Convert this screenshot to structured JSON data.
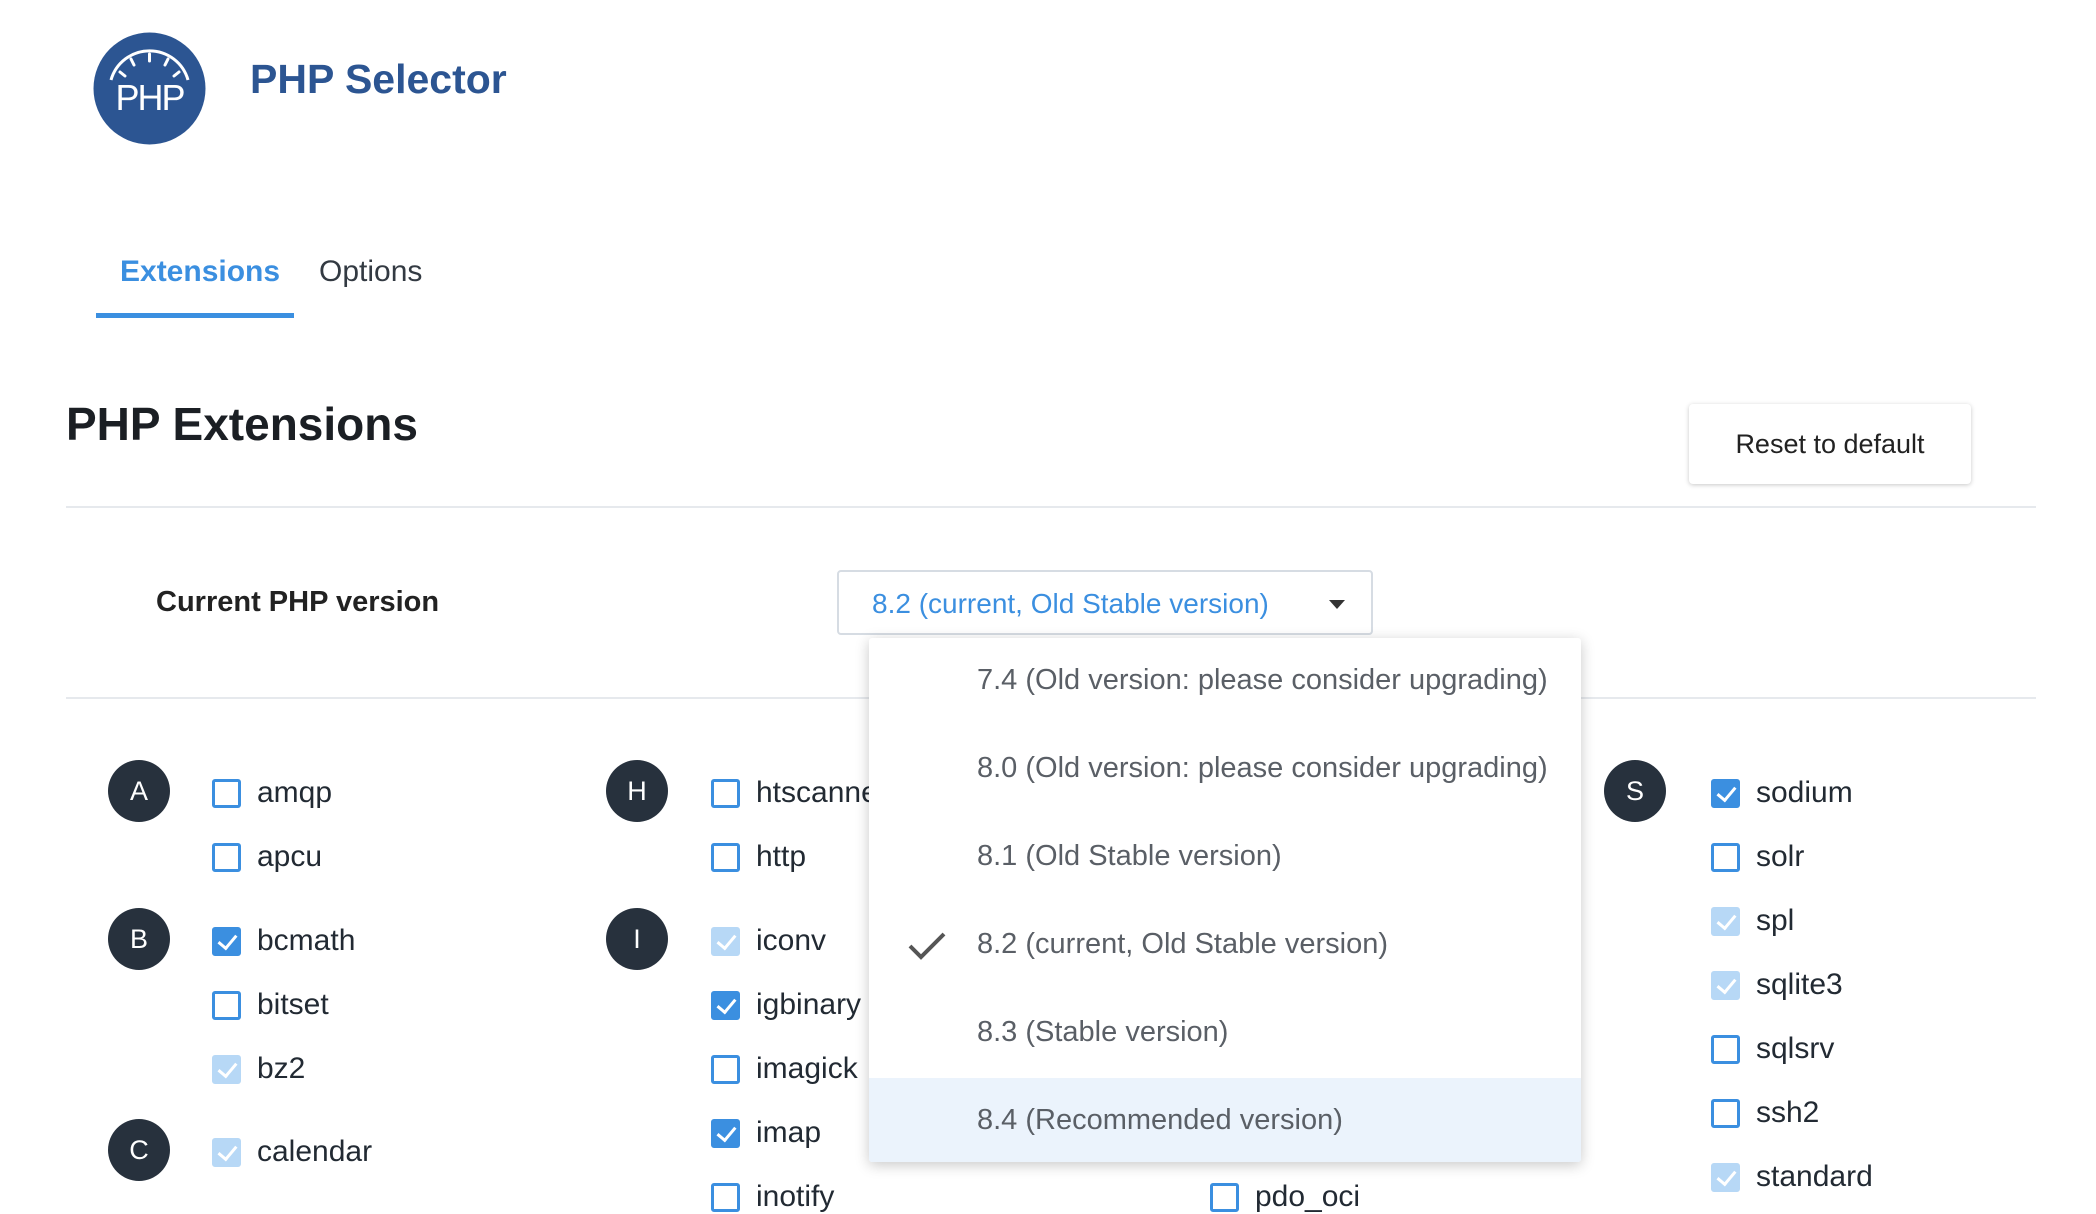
{
  "app": {
    "title": "PHP Selector",
    "logo_text": "PHP",
    "brand_color": "#2c5592"
  },
  "tabs": [
    {
      "label": "Extensions",
      "active": true
    },
    {
      "label": "Options",
      "active": false
    }
  ],
  "section": {
    "title": "PHP Extensions",
    "reset_label": "Reset to default"
  },
  "version": {
    "label": "Current PHP version",
    "selected": "8.2 (current, Old Stable version)",
    "options": [
      {
        "label": "7.4 (Old version: please consider upgrading)",
        "checked": false,
        "highlighted": false
      },
      {
        "label": "8.0 (Old version: please consider upgrading)",
        "checked": false,
        "highlighted": false
      },
      {
        "label": "8.1 (Old Stable version)",
        "checked": false,
        "highlighted": false
      },
      {
        "label": "8.2 (current, Old Stable version)",
        "checked": true,
        "highlighted": false
      },
      {
        "label": "8.3 (Stable version)",
        "checked": false,
        "highlighted": false
      },
      {
        "label": "8.4 (Recommended version)",
        "checked": false,
        "highlighted": true
      }
    ]
  },
  "extension_groups": {
    "A": {
      "letter": "A",
      "items": [
        {
          "name": "amqp",
          "state": "unchecked"
        },
        {
          "name": "apcu",
          "state": "unchecked"
        }
      ]
    },
    "B": {
      "letter": "B",
      "items": [
        {
          "name": "bcmath",
          "state": "checked"
        },
        {
          "name": "bitset",
          "state": "unchecked"
        },
        {
          "name": "bz2",
          "state": "checked-disabled"
        }
      ]
    },
    "C": {
      "letter": "C",
      "items": [
        {
          "name": "calendar",
          "state": "checked-disabled"
        }
      ]
    },
    "H": {
      "letter": "H",
      "items": [
        {
          "name": "htscanne",
          "state": "unchecked"
        },
        {
          "name": "http",
          "state": "unchecked"
        }
      ]
    },
    "I": {
      "letter": "I",
      "items": [
        {
          "name": "iconv",
          "state": "checked-disabled"
        },
        {
          "name": "igbinary",
          "state": "checked"
        },
        {
          "name": "imagick",
          "state": "unchecked"
        },
        {
          "name": "imap",
          "state": "checked"
        },
        {
          "name": "inotify",
          "state": "unchecked"
        }
      ]
    },
    "P": {
      "items": [
        {
          "name": "pdo_oci",
          "state": "unchecked"
        }
      ]
    },
    "S": {
      "letter": "S",
      "items": [
        {
          "name": "sodium",
          "state": "checked"
        },
        {
          "name": "solr",
          "state": "unchecked"
        },
        {
          "name": "spl",
          "state": "checked-disabled"
        },
        {
          "name": "sqlite3",
          "state": "checked-disabled"
        },
        {
          "name": "sqlsrv",
          "state": "unchecked"
        },
        {
          "name": "ssh2",
          "state": "unchecked"
        },
        {
          "name": "standard",
          "state": "checked-disabled"
        }
      ]
    }
  },
  "colors": {
    "accent": "#3b8fe0",
    "letter_badge": "#27313d",
    "menu_highlight": "#ebf3fc"
  }
}
